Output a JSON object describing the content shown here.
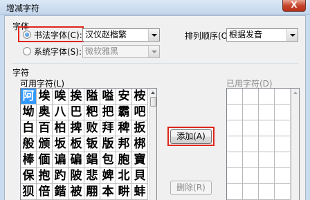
{
  "window": {
    "title": "增减字符",
    "close_symbol": "X"
  },
  "font_group": {
    "label": "字体",
    "calligraphy_radio": {
      "label": "书法字体(C):",
      "checked": true
    },
    "calligraphy_font": {
      "value": "汉仪赵楷繁"
    },
    "system_radio": {
      "label": "系统字体(S):",
      "checked": false
    },
    "system_font": {
      "value": "微软雅黑"
    },
    "sort_label": "排列顺序(O):",
    "sort_select": {
      "value": "根据发音"
    }
  },
  "chars_group": {
    "label": "字符",
    "available_label": "可用字符(L)",
    "used_label": "已用字符(D)",
    "available_rows": [
      [
        "阿",
        "埃",
        "唉",
        "挨",
        "隘",
        "嗌",
        "安",
        "桉"
      ],
      [
        "坳",
        "奥",
        "八",
        "巴",
        "粑",
        "把",
        "霸",
        "吧"
      ],
      [
        "白",
        "百",
        "柏",
        "捭",
        "败",
        "拜",
        "稗",
        "扳"
      ],
      [
        "般",
        "颁",
        "坂",
        "板",
        "钣",
        "版",
        "邦",
        "梆"
      ],
      [
        "棒",
        "偭",
        "谝",
        "碥",
        "錩",
        "包",
        "胞",
        "寶"
      ],
      [
        "保",
        "抱",
        "趵",
        "陂",
        "悲",
        "婢",
        "北",
        "貝"
      ],
      [
        "狈",
        "倍",
        "鍇",
        "被",
        "翢",
        "本",
        "畊",
        "蚌"
      ]
    ],
    "selected_char": "阿",
    "add_button": "添加(A)",
    "remove_button": "删除(R)"
  }
}
